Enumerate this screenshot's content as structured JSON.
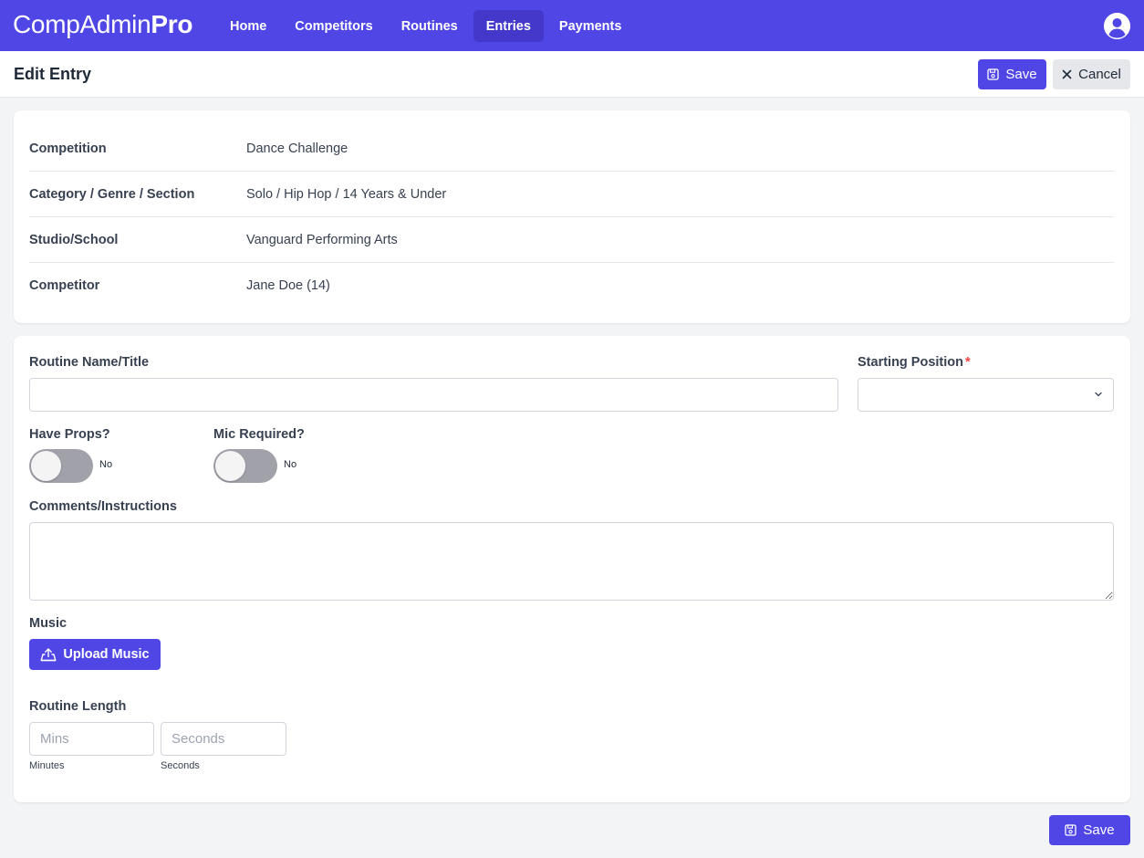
{
  "app": {
    "brand_part1": "CompAdmin",
    "brand_part2": "Pro"
  },
  "nav": {
    "items": [
      {
        "label": "Home",
        "active": false
      },
      {
        "label": "Competitors",
        "active": false
      },
      {
        "label": "Routines",
        "active": false
      },
      {
        "label": "Entries",
        "active": true
      },
      {
        "label": "Payments",
        "active": false
      }
    ],
    "avatar_icon": "user-circle-icon"
  },
  "header": {
    "title": "Edit Entry",
    "save_label": "Save",
    "cancel_label": "Cancel"
  },
  "details": {
    "rows": [
      {
        "label": "Competition",
        "value": "Dance Challenge"
      },
      {
        "label": "Category / Genre / Section",
        "value": "Solo / Hip Hop / 14 Years & Under"
      },
      {
        "label": "Studio/School",
        "value": "Vanguard Performing Arts"
      },
      {
        "label": "Competitor",
        "value": "Jane Doe (14)"
      }
    ]
  },
  "form": {
    "routine_name_label": "Routine Name/Title",
    "routine_name_value": "",
    "starting_position_label": "Starting Position",
    "starting_position_required": "*",
    "starting_position_value": "",
    "have_props_label": "Have Props?",
    "have_props_state": "No",
    "mic_required_label": "Mic Required?",
    "mic_required_state": "No",
    "comments_label": "Comments/Instructions",
    "comments_value": "",
    "music_label": "Music",
    "upload_music_label": "Upload Music",
    "routine_length_label": "Routine Length",
    "mins_placeholder": "Mins",
    "seconds_placeholder": "Seconds",
    "minutes_hint": "Minutes",
    "seconds_hint": "Seconds"
  },
  "footer": {
    "save_label": "Save"
  },
  "colors": {
    "primary": "#4f46e5",
    "primary_active": "#4338ca",
    "required": "#ef4444",
    "toggle_off": "#a1a1aa"
  }
}
